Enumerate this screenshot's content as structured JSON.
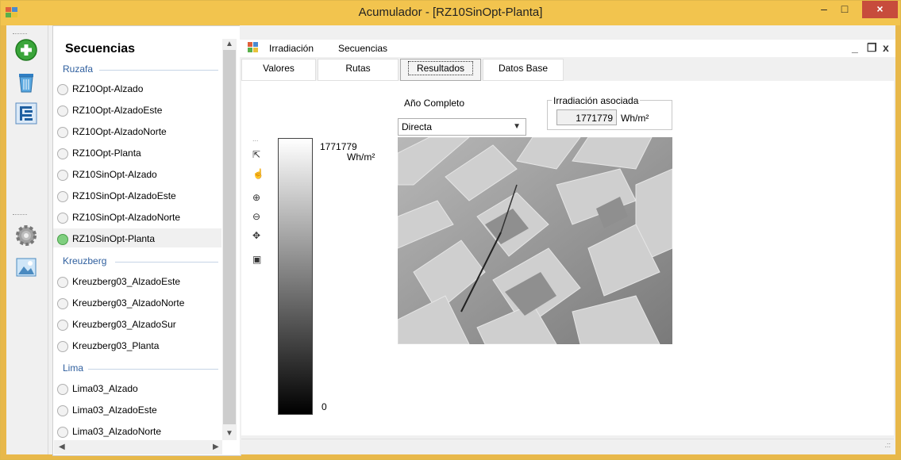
{
  "window": {
    "title": "Acumulador - [RZ10SinOpt-Planta]",
    "minimize": "–",
    "maximize": "□",
    "close": "×"
  },
  "toolbar_icons": [
    "add-icon",
    "trash-icon",
    "tree-icon",
    "gear-icon",
    "image-icon"
  ],
  "sequences": {
    "title": "Secuencias",
    "groups": [
      {
        "name": "Ruzafa",
        "items": [
          "RZ10Opt-Alzado",
          "RZ10Opt-AlzadoEste",
          "RZ10Opt-AlzadoNorte",
          "RZ10Opt-Planta",
          "RZ10SinOpt-Alzado",
          "RZ10SinOpt-AlzadoEste",
          "RZ10SinOpt-AlzadoNorte",
          "RZ10SinOpt-Planta"
        ]
      },
      {
        "name": "Kreuzberg",
        "items": [
          "Kreuzberg03_AlzadoEste",
          "Kreuzberg03_AlzadoNorte",
          "Kreuzberg03_AlzadoSur",
          "Kreuzberg03_Planta"
        ]
      },
      {
        "name": "Lima",
        "items": [
          "Lima03_Alzado",
          "Lima03_AlzadoEste",
          "Lima03_AlzadoNorte"
        ]
      }
    ],
    "selected": "RZ10SinOpt-Planta"
  },
  "menu": {
    "items": [
      "Irradiación",
      "Secuencias"
    ],
    "mdi_minimize": "_",
    "mdi_restore": "❐",
    "mdi_close": "x"
  },
  "tabs": [
    "Valores",
    "Rutas",
    "Resultados",
    "Datos Base"
  ],
  "active_tab": "Resultados",
  "results": {
    "period_label": "Año Completo",
    "irradiance_type": "Directa",
    "associated_group_title": "Irradiación asociada",
    "associated_value": "1771779",
    "associated_unit": "Wh/m²",
    "legend_max": "1771779",
    "legend_unit": "Wh/m²",
    "legend_min": "0"
  },
  "map_tools": [
    "pointer-icon",
    "pan-hand-icon",
    "zoom-in-icon",
    "zoom-out-icon",
    "fit-extent-icon",
    "save-icon"
  ],
  "statusbar": {
    "grip": ".::"
  }
}
